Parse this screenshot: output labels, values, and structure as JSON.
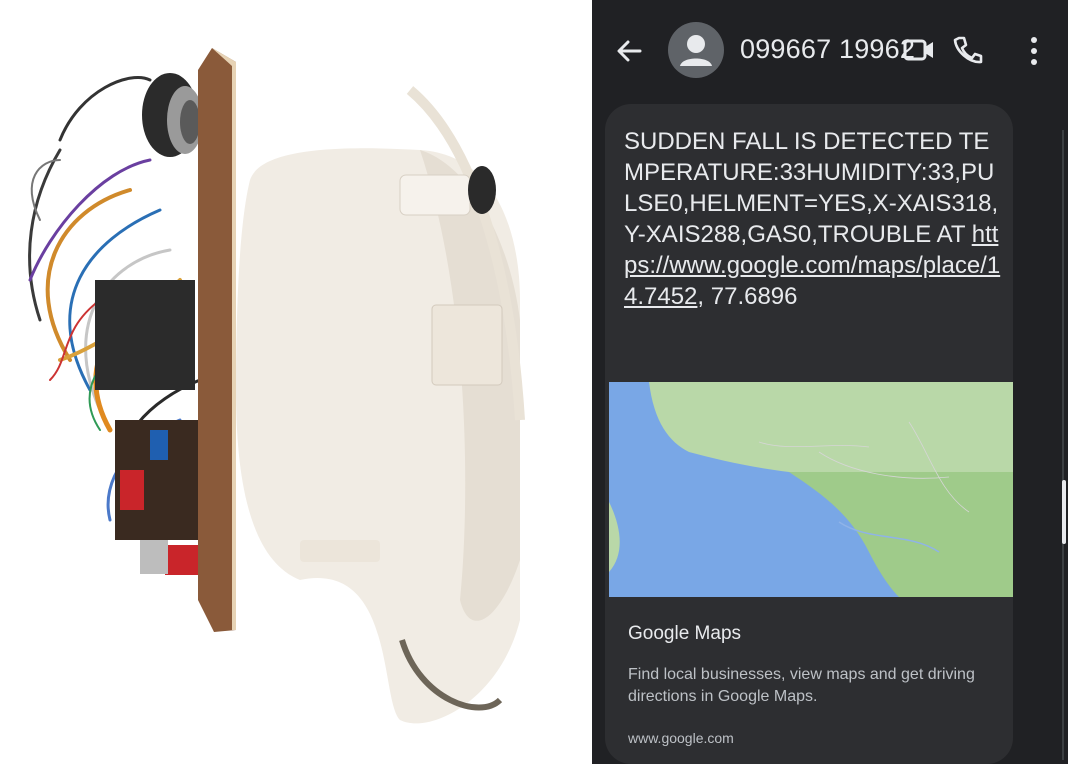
{
  "photo": {
    "alt_subject": "helmet-device-photo"
  },
  "header": {
    "phone_number": "099667 19962"
  },
  "message": {
    "body_text": "SUDDEN FALL IS DETECTED TEMPERATURE:33HUMIDITY:33,PULSE0,HELMENT=YES,X-XAIS318,Y-XAIS288,GAS0,TROUBLE AT ",
    "link_text": "https://www.google.com/maps/place/14.7452",
    "trailing_text": ", 77.6896"
  },
  "link_preview": {
    "title": "Google Maps",
    "description": "Find local businesses, view maps and get driving directions in Google Maps.",
    "domain": "www.google.com"
  },
  "colors": {
    "background": "#202124",
    "bubble": "#2d2e31",
    "text": "#e8eaed",
    "water": "#79a7e6",
    "land": "#b9d8a8"
  },
  "icons": [
    "back-arrow-icon",
    "avatar-icon",
    "video-call-icon",
    "phone-call-icon",
    "more-vert-icon"
  ]
}
